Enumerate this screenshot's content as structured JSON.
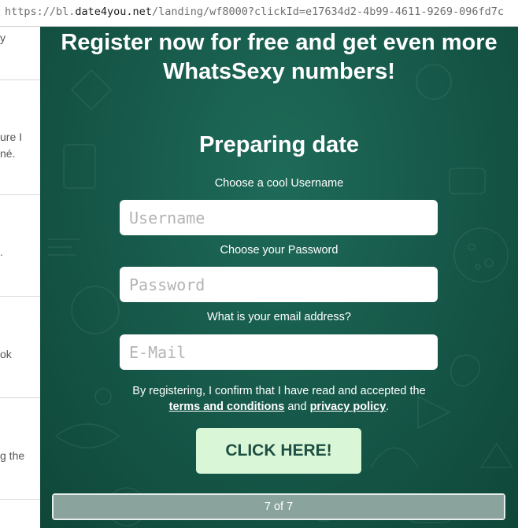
{
  "browser": {
    "url_prefix": "https://bl.",
    "url_domain": "date4you.net",
    "url_suffix": "/landing/wf8000?clickId=e17634d2-4b99-4611-9269-096fd7c"
  },
  "background_page": {
    "fragments": [
      "y",
      "ure I",
      "né.",
      ".",
      "ok",
      "g the"
    ]
  },
  "modal": {
    "headline_line1": "Register now for free and get even more",
    "headline_line2": "WhatsSexy numbers!",
    "subtitle": "Preparing date",
    "username": {
      "label": "Choose a cool Username",
      "placeholder": "Username",
      "value": ""
    },
    "password": {
      "label": "Choose your Password",
      "placeholder": "Password",
      "value": ""
    },
    "email": {
      "label": "What is your email address?",
      "placeholder": "E-Mail",
      "value": ""
    },
    "consent_text": "By registering, I confirm that I have read and accepted the",
    "terms_link": "terms and conditions",
    "consent_and": "and",
    "privacy_link": "privacy policy",
    "consent_end": ".",
    "cta_label": "CLICK HERE!",
    "progress_text": "7 of 7",
    "progress_fraction": 1.0
  },
  "colors": {
    "modal_bg": "#175a4b",
    "cta_bg": "#d9f7d6",
    "cta_text": "#1f4f44"
  }
}
